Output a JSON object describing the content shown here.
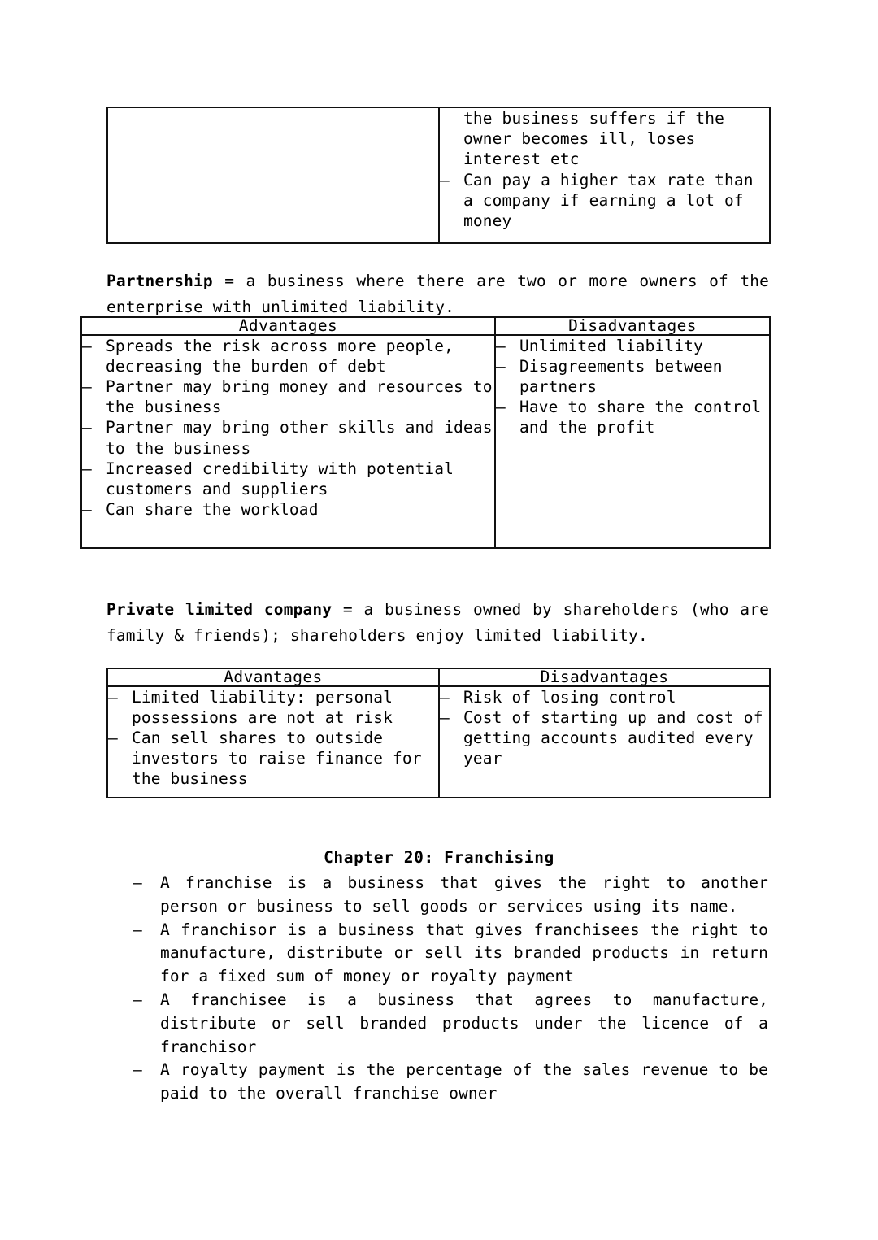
{
  "page": {
    "background": "#ffffff",
    "ink": "#000000"
  },
  "continued_table": {
    "left_cell": "",
    "right_cell_lead": "the business suffers if the owner becomes ill, loses interest etc",
    "right_cell_items": [
      "Can pay a higher tax rate than a company if earning a lot of money"
    ]
  },
  "partnership": {
    "term": "Partnership",
    "equals": " = ",
    "definition": "a business where there are two or more owners of the enterprise with unlimited liability.",
    "table": {
      "headers": {
        "advantages": "Advantages",
        "disadvantages": "Disadvantages"
      },
      "advantages": [
        "Spreads the risk across more people, decreasing the burden of debt",
        "Partner may bring money and resources to the business",
        "Partner may bring other skills and ideas to the business",
        "Increased credibility with potential customers and suppliers",
        "Can share the workload"
      ],
      "disadvantages": [
        "Unlimited liability",
        "Disagreements between partners",
        "Have to share the control and the profit"
      ]
    }
  },
  "private_limited_company": {
    "term": "Private limited company",
    "equals": " = ",
    "definition": "a business owned by shareholders (who are family & friends); shareholders enjoy limited liability.",
    "table": {
      "headers": {
        "advantages": "Advantages",
        "disadvantages": "Disadvantages"
      },
      "advantages": [
        "Limited liability: personal possessions are not at risk",
        "Can sell shares to outside investors to raise finance for the business"
      ],
      "disadvantages": [
        "Risk of losing control",
        "Cost of starting up and cost of getting accounts audited every year"
      ]
    }
  },
  "chapter": {
    "heading": "Chapter 20: Franchising",
    "points": [
      "A franchise is a business that gives the right to another person or business to sell goods or services using its name.",
      "A franchisor is a business that gives franchisees the right to manufacture, distribute or sell its branded products in return for a fixed sum of money or royalty payment",
      "A franchisee is a business that agrees to manufacture, distribute or sell branded products under the licence of a franchisor",
      "A royalty payment is the percentage of the sales revenue to be paid to the overall franchise owner"
    ]
  }
}
